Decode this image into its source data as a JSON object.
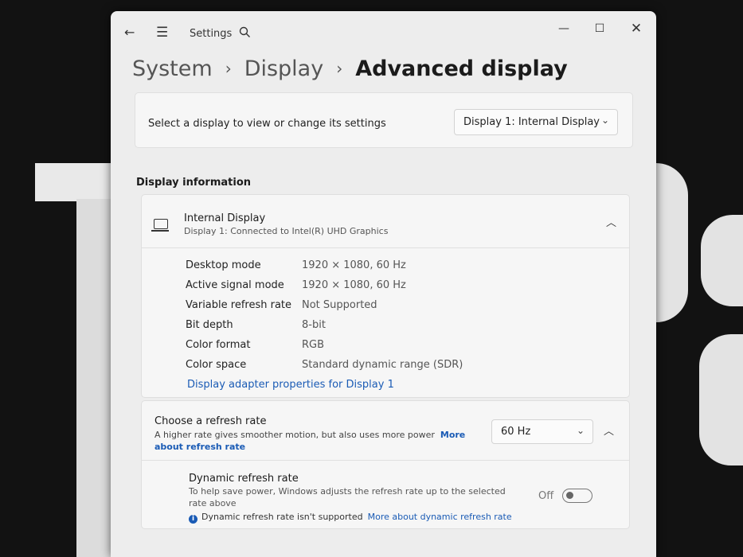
{
  "window": {
    "app_title": "Settings",
    "icons": {
      "back": "back-arrow-icon",
      "menu": "hamburger-menu-icon",
      "search": "search-icon",
      "minimize": "minimize-icon",
      "maximize": "maximize-icon",
      "close": "close-icon"
    }
  },
  "breadcrumb": {
    "items": [
      "System",
      "Display"
    ],
    "current": "Advanced display",
    "separator": "›"
  },
  "display_select": {
    "label": "Select a display to view or change its settings",
    "selected": "Display 1: Internal Display"
  },
  "display_information": {
    "section_title": "Display information",
    "display_name": "Internal Display",
    "display_subtitle": "Display 1: Connected to Intel(R) UHD Graphics",
    "rows": [
      {
        "key": "Desktop mode",
        "value": "1920 × 1080, 60 Hz"
      },
      {
        "key": "Active signal mode",
        "value": "1920 × 1080, 60 Hz"
      },
      {
        "key": "Variable refresh rate",
        "value": "Not Supported"
      },
      {
        "key": "Bit depth",
        "value": "8-bit"
      },
      {
        "key": "Color format",
        "value": "RGB"
      },
      {
        "key": "Color space",
        "value": "Standard dynamic range (SDR)"
      }
    ],
    "adapter_link": "Display adapter properties for Display 1"
  },
  "refresh_rate": {
    "title": "Choose a refresh rate",
    "description": "A higher rate gives smoother motion, but also uses more power",
    "more_link": "More about refresh rate",
    "more_link_line1": "More",
    "more_link_line2": "about refresh rate",
    "selected": "60 Hz",
    "dynamic": {
      "title": "Dynamic refresh rate",
      "description": "To help save power, Windows adjusts the refresh rate up to the selected rate above",
      "toggle_label": "Off",
      "toggle_on": false,
      "note": "Dynamic refresh rate isn't supported",
      "note_link": "More about dynamic refresh rate"
    }
  },
  "colors": {
    "accent": "#1a5bb5",
    "window_bg": "#ededed",
    "card_bg": "#f6f6f6"
  }
}
